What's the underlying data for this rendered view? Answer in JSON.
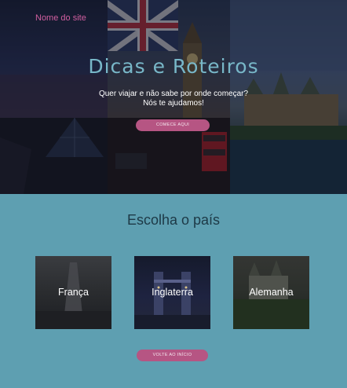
{
  "header": {
    "site_name": "Nome do site"
  },
  "hero": {
    "title": "Dicas e Roteiros",
    "subtitle_line1": "Quer viajar e não sabe por onde começar?",
    "subtitle_line2": "Nós te ajudamos!",
    "cta_label": "Comece aqui"
  },
  "countries": {
    "heading": "Escolha o país",
    "cards": [
      {
        "label": "França"
      },
      {
        "label": "Inglaterra"
      },
      {
        "label": "Alemanha"
      }
    ]
  },
  "footer": {
    "back_label": "Volte ao início"
  },
  "colors": {
    "background": "#5e9fb1",
    "accent_pink": "#b65583",
    "title_teal": "#78b7c8"
  }
}
